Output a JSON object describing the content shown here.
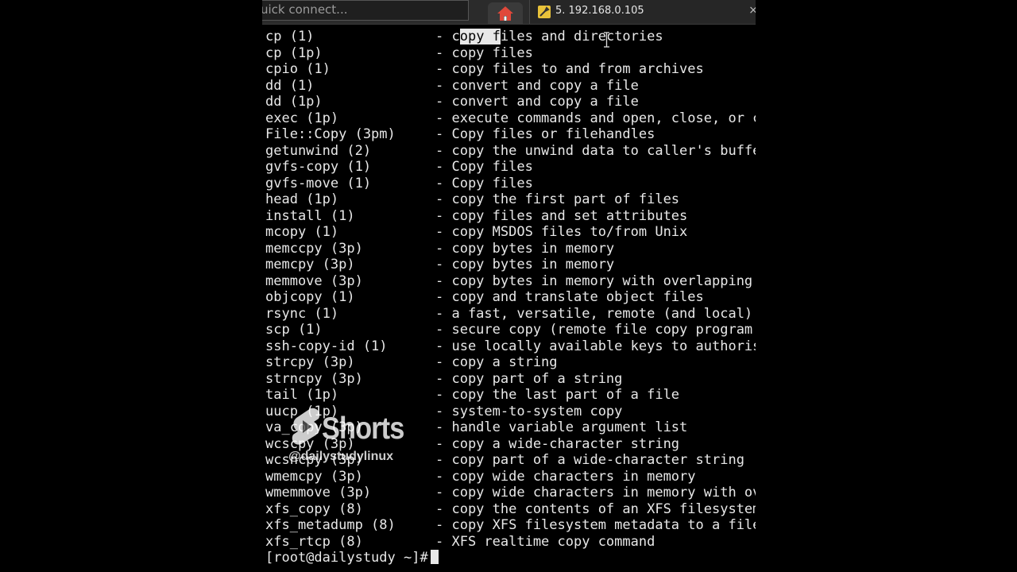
{
  "quick_connect": {
    "text": "uick connect..."
  },
  "tab": {
    "label": "5. 192.168.0.105",
    "close": "×"
  },
  "terminal": {
    "rows": [
      {
        "cmd": "cp (1)",
        "desc": "- copy files and directories"
      },
      {
        "cmd": "cp (1p)",
        "desc": "- copy files"
      },
      {
        "cmd": "cpio (1)",
        "desc": "- copy files to and from archives"
      },
      {
        "cmd": "dd (1)",
        "desc": "- convert and copy a file"
      },
      {
        "cmd": "dd (1p)",
        "desc": "- convert and copy a file"
      },
      {
        "cmd": "exec (1p)",
        "desc": "- execute commands and open, close, or c"
      },
      {
        "cmd": "File::Copy (3pm)",
        "desc": "- Copy files or filehandles"
      },
      {
        "cmd": "getunwind (2)",
        "desc": "- copy the unwind data to caller's buffe"
      },
      {
        "cmd": "gvfs-copy (1)",
        "desc": "- Copy files"
      },
      {
        "cmd": "gvfs-move (1)",
        "desc": "- Copy files"
      },
      {
        "cmd": "head (1p)",
        "desc": "- copy the first part of files"
      },
      {
        "cmd": "install (1)",
        "desc": "- copy files and set attributes"
      },
      {
        "cmd": "mcopy (1)",
        "desc": "- copy MSDOS files to/from Unix"
      },
      {
        "cmd": "memccpy (3p)",
        "desc": "- copy bytes in memory"
      },
      {
        "cmd": "memcpy (3p)",
        "desc": "- copy bytes in memory"
      },
      {
        "cmd": "memmove (3p)",
        "desc": "- copy bytes in memory with overlapping"
      },
      {
        "cmd": "objcopy (1)",
        "desc": "- copy and translate object files"
      },
      {
        "cmd": "rsync (1)",
        "desc": "- a fast, versatile, remote (and local)"
      },
      {
        "cmd": "scp (1)",
        "desc": "- secure copy (remote file copy program"
      },
      {
        "cmd": "ssh-copy-id (1)",
        "desc": "- use locally available keys to authoris"
      },
      {
        "cmd": "strcpy (3p)",
        "desc": "- copy a string"
      },
      {
        "cmd": "strncpy (3p)",
        "desc": "- copy part of a string"
      },
      {
        "cmd": "tail (1p)",
        "desc": "- copy the last part of a file"
      },
      {
        "cmd": "uucp (1p)",
        "desc": "- system-to-system copy"
      },
      {
        "cmd": "va_copy (3p)",
        "desc": "- handle variable argument list"
      },
      {
        "cmd": "wcscpy (3p)",
        "desc": "- copy a wide-character string"
      },
      {
        "cmd": "wcsncpy (3p)",
        "desc": "- copy part of a wide-character string"
      },
      {
        "cmd": "wmemcpy (3p)",
        "desc": "- copy wide characters in memory"
      },
      {
        "cmd": "wmemmove (3p)",
        "desc": "- copy wide characters in memory with ov"
      },
      {
        "cmd": "xfs_copy (8)",
        "desc": "- copy the contents of an XFS filesystem"
      },
      {
        "cmd": "xfs_metadump (8)",
        "desc": "- copy XFS filesystem metadata to a file"
      },
      {
        "cmd": "xfs_rtcp (8)",
        "desc": "- XFS realtime copy command"
      }
    ],
    "first_row_parts": {
      "pre": "- c",
      "hl": "opy f",
      "post": "iles and directories"
    },
    "prompt": "[root@dailystudy ~]#"
  },
  "overlay": {
    "brand": "Shorts",
    "handle": "@dailystudylinux"
  },
  "icons": {
    "home": "home-icon",
    "session": "wrench-icon",
    "pointer": "text-cursor-icon",
    "shorts": "shorts-logo-icon"
  },
  "colors": {
    "home_icon": "#e0483a",
    "session_icon": "#e8c23a",
    "terminal_bg": "#000000",
    "terminal_fg": "#e8e8e8"
  }
}
